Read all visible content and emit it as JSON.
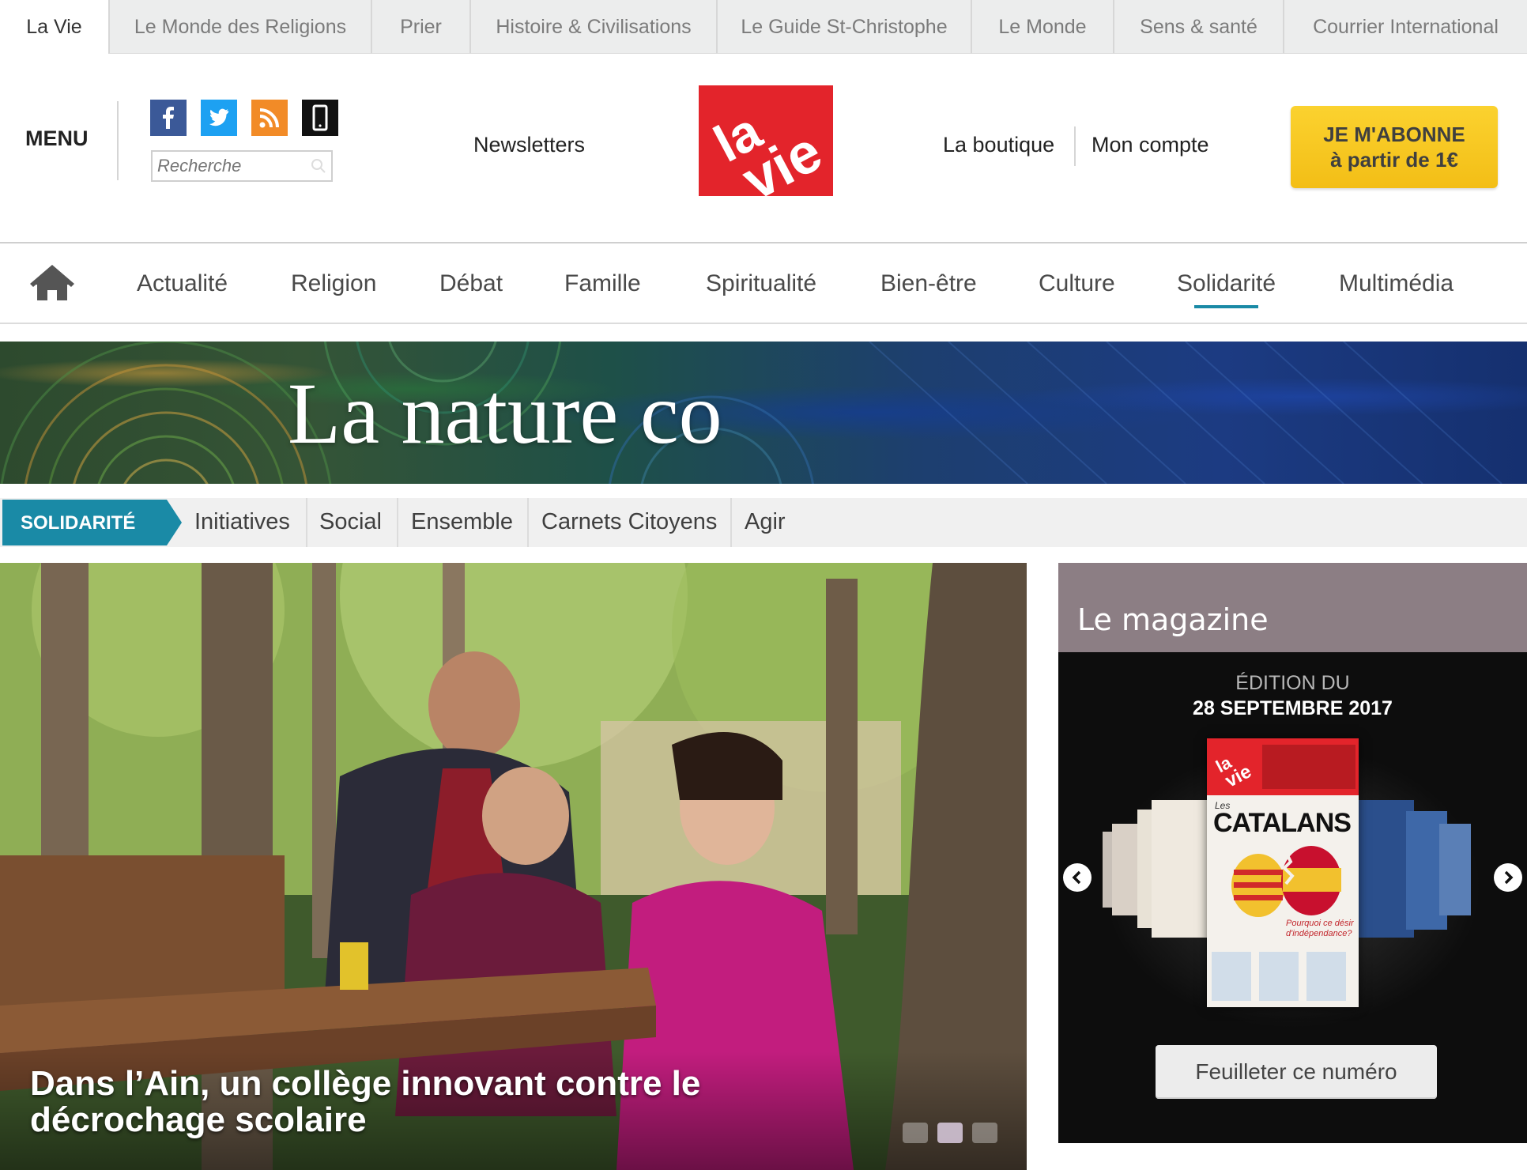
{
  "network": {
    "sites": [
      "La Vie",
      "Le Monde des Religions",
      "Prier",
      "Histoire & Civilisations",
      "Le Guide St-Christophe",
      "Le Monde",
      "Sens & santé",
      "Courrier International"
    ]
  },
  "header": {
    "menu_label": "MENU",
    "search_placeholder": "Recherche",
    "newsletters": "Newsletters",
    "logo_text": "la vie",
    "boutique": "La boutique",
    "account": "Mon compte",
    "subscribe_line1": "JE M'ABONNE",
    "subscribe_line2": "à partir de 1€",
    "social_icons": [
      "facebook-icon",
      "twitter-icon",
      "rss-icon",
      "mobile-icon"
    ]
  },
  "nav": {
    "items": [
      "Actualité",
      "Religion",
      "Débat",
      "Famille",
      "Spiritualité",
      "Bien-être",
      "Culture",
      "Solidarité",
      "Multimédia"
    ],
    "active": "Solidarité"
  },
  "banner": {
    "title": "La nature co"
  },
  "section": {
    "tag": "SOLIDARITÉ",
    "items": [
      "Initiatives",
      "Social",
      "Ensemble",
      "Carnets Citoyens",
      "Agir"
    ]
  },
  "hero": {
    "title": "Dans l’Ain, un collège innovant contre le décrochage scolaire",
    "slide_count": 3,
    "active_slide": 2
  },
  "magazine": {
    "header": "Le magazine",
    "edition_label": "ÉDITION DU",
    "edition_date": "28 SEPTEMBRE 2017",
    "cover_les": "Les",
    "cover_headline": "CATALANS",
    "cover_subline": "Pourquoi ce désir d'indépendance?",
    "button": "Feuilleter ce numéro"
  },
  "colors": {
    "accent": "#1a8aa6",
    "brand_red": "#e3242b",
    "subscribe_yellow": "#f6c81e",
    "magazine_header": "#8c7e84"
  }
}
